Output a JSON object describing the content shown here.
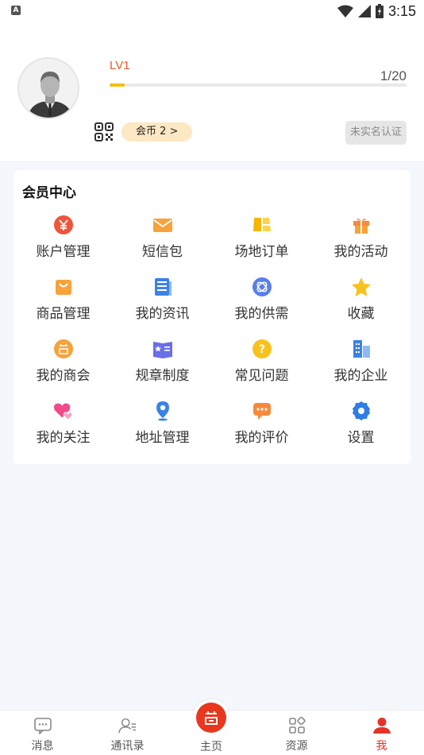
{
  "status_bar": {
    "badge": "A",
    "time": "3:15"
  },
  "profile": {
    "level": "LV1",
    "progress_text": "1/20",
    "progress_fraction": 0.05,
    "coins_label": "会币 2 >",
    "verify_label": "未实名认证"
  },
  "member_center": {
    "title": "会员中心",
    "items": [
      {
        "label": "账户管理",
        "icon": "yen-icon"
      },
      {
        "label": "短信包",
        "icon": "envelope-icon"
      },
      {
        "label": "场地订单",
        "icon": "venue-icon"
      },
      {
        "label": "我的活动",
        "icon": "gift-icon"
      },
      {
        "label": "商品管理",
        "icon": "shopping-bag-icon"
      },
      {
        "label": "我的资讯",
        "icon": "news-icon"
      },
      {
        "label": "我的供需",
        "icon": "exchange-icon"
      },
      {
        "label": "收藏",
        "icon": "star-icon"
      },
      {
        "label": "我的商会",
        "icon": "chamber-icon"
      },
      {
        "label": "规章制度",
        "icon": "rulebook-icon"
      },
      {
        "label": "常见问题",
        "icon": "question-icon"
      },
      {
        "label": "我的企业",
        "icon": "building-icon"
      },
      {
        "label": "我的关注",
        "icon": "hearts-icon"
      },
      {
        "label": "地址管理",
        "icon": "location-pin-icon"
      },
      {
        "label": "我的评价",
        "icon": "comment-icon"
      },
      {
        "label": "设置",
        "icon": "gear-icon"
      }
    ]
  },
  "tabbar": {
    "messages": "消息",
    "contacts": "通讯录",
    "home": "主页",
    "resources": "资源",
    "me": "我"
  },
  "colors": {
    "accent": "#e3342a",
    "level": "#f05a28",
    "progress": "#f6c000",
    "coins_bg": "#fde8c4"
  }
}
